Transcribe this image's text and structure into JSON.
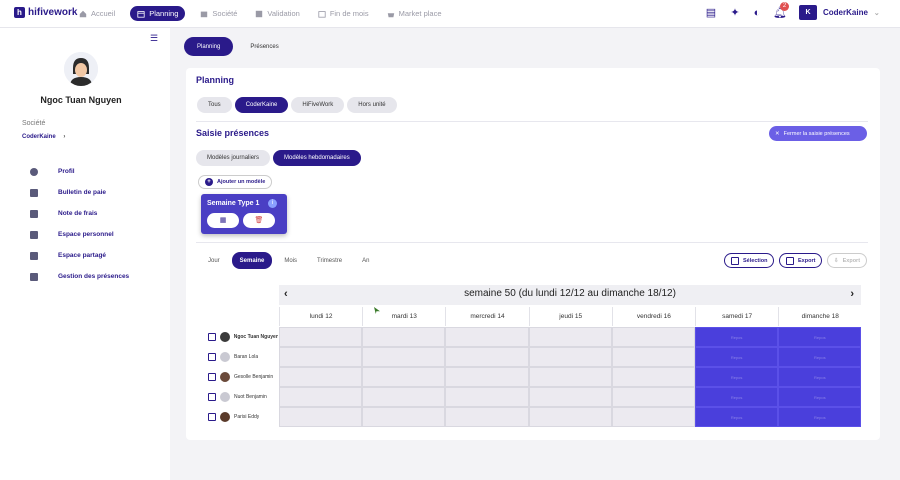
{
  "topbar": {
    "logo": "hifivework",
    "nav": [
      {
        "label": "Accueil",
        "icon": "home-icon",
        "active": false
      },
      {
        "label": "Planning",
        "icon": "calendar-icon",
        "active": true
      },
      {
        "label": "Société",
        "icon": "building-icon",
        "active": false
      },
      {
        "label": "Validation",
        "icon": "check-icon",
        "active": false
      },
      {
        "label": "Fin de mois",
        "icon": "calendar-icon",
        "active": false
      },
      {
        "label": "Market place",
        "icon": "basket-icon",
        "active": false
      }
    ],
    "notification_count": "2",
    "user_name": "CoderKaine",
    "user_logo": "K"
  },
  "sidebar": {
    "name": "Ngoc Tuan Nguyen",
    "societe_label": "Société",
    "societe_value": "CoderKaine",
    "menu": [
      {
        "label": "Profil",
        "icon": "person-icon"
      },
      {
        "label": "Bulletin de paie",
        "icon": "document-icon"
      },
      {
        "label": "Note de frais",
        "icon": "receipt-icon"
      },
      {
        "label": "Espace personnel",
        "icon": "folder-user-icon"
      },
      {
        "label": "Espace partagé",
        "icon": "folder-icon"
      },
      {
        "label": "Gestion des présences",
        "icon": "calendar-check-icon"
      }
    ]
  },
  "main": {
    "tabs": [
      "Planning",
      "Présences"
    ],
    "planning_title": "Planning",
    "filters": [
      "Tous",
      "CoderKaine",
      "HiFiveWork",
      "Hors unité"
    ],
    "saisie_title": "Saisie présences",
    "close_button": "Fermer la saisie présences",
    "model_tabs": [
      "Modèles journaliers",
      "Modèles hebdomadaires"
    ],
    "add_model": "Ajouter un modèle",
    "card_title": "Semaine Type 1",
    "periods": [
      "Jour",
      "Semaine",
      "Mois",
      "Trimestre",
      "An"
    ],
    "actions": {
      "selection": "Sélection",
      "export": "Export",
      "export2": "Export"
    },
    "week_label": "semaine 50 (du lundi 12/12 au dimanche 18/12)",
    "days": [
      "lundi 12",
      "mardi 13",
      "mercredi 14",
      "jeudi 15",
      "vendredi 16",
      "samedi 17",
      "dimanche 18"
    ],
    "employees": [
      "Ngoc Tuan Nguyen",
      "Baran Lola",
      "Gesolle Benjamin",
      "Nuot Benjamin",
      "Parisi Eddy"
    ],
    "weekend_cells": [
      [
        "Repos",
        "Repos"
      ],
      [
        "Repos",
        "Repos"
      ],
      [
        "Repos",
        "Repos"
      ],
      [
        "Repos",
        "Repos"
      ],
      [
        "Repos",
        "Repos"
      ]
    ]
  },
  "colors": {
    "primary": "#2a1a8a",
    "accent": "#6b5fe6",
    "weekend": "#4a3fdc"
  }
}
